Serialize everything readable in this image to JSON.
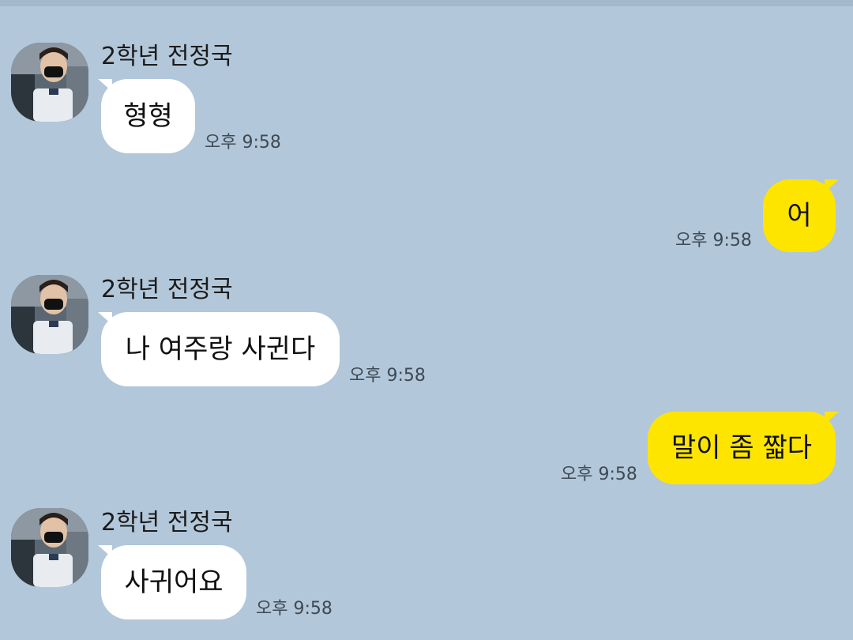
{
  "colors": {
    "background": "#b2c7da",
    "incoming_bubble": "#ffffff",
    "outgoing_bubble": "#fee500",
    "timestamp": "#3e4a55"
  },
  "messages": [
    {
      "direction": "incoming",
      "sender": "2학년 전정국",
      "text": "형형",
      "time": "오후 9:58"
    },
    {
      "direction": "outgoing",
      "text": "어",
      "time": "오후 9:58"
    },
    {
      "direction": "incoming",
      "sender": "2학년 전정국",
      "text": "나 여주랑 사귄다",
      "time": "오후 9:58"
    },
    {
      "direction": "outgoing",
      "text": "말이 좀 짧다",
      "time": "오후 9:58"
    },
    {
      "direction": "incoming",
      "sender": "2학년 전정국",
      "text": "사귀어요",
      "time": "오후 9:58"
    }
  ]
}
